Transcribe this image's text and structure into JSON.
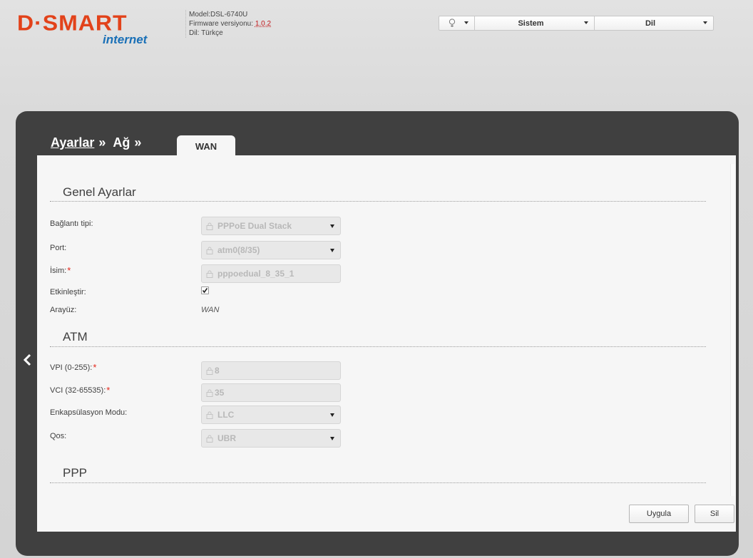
{
  "brand": {
    "logo_main": "D·SMART",
    "logo_sub": "internet"
  },
  "device": {
    "model_label": "Model:",
    "model": "DSL-6740U",
    "firmware_label": "Firmware versiyonu:",
    "firmware": "1.0.2",
    "language_label": "Dil:",
    "language": "Türkçe"
  },
  "topmenu": {
    "hint_icon": "lightbulb-icon",
    "system_label": "Sistem",
    "language_label": "Dil"
  },
  "breadcrumb": {
    "level1": "Ayarlar",
    "level2": "Ağ",
    "separator": "»",
    "active_tab": "WAN"
  },
  "sections": {
    "general": "Genel Ayarlar",
    "atm": "ATM",
    "ppp": "PPP"
  },
  "general": {
    "connection_type_label": "Bağlantı tipi:",
    "connection_type_value": "PPPoE Dual Stack",
    "port_label": "Port:",
    "port_value": "atm0(8/35)",
    "name_label": "İsim:",
    "name_value": "pppoedual_8_35_1",
    "enable_label": "Etkinleştir:",
    "enable_checked": true,
    "interface_label": "Arayüz:",
    "interface_value": "WAN"
  },
  "atm": {
    "vpi_label": "VPI (0-255):",
    "vpi_value": "8",
    "vci_label": "VCI (32-65535):",
    "vci_value": "35",
    "encap_label": "Enkapsülasyon Modu:",
    "encap_value": "LLC",
    "qos_label": "Qos:",
    "qos_value": "UBR"
  },
  "required_mark": "*",
  "buttons": {
    "apply": "Uygula",
    "delete": "Sil"
  },
  "colors": {
    "brand_orange": "#e2421a",
    "brand_blue": "#1a70b7",
    "frame": "#404040",
    "required": "#e3261a"
  }
}
